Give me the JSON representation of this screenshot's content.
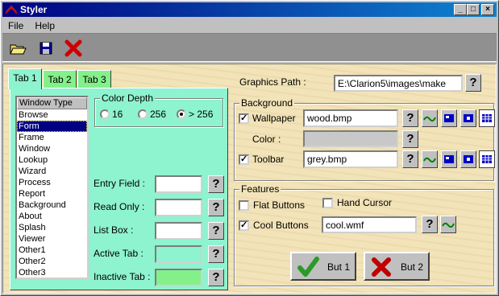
{
  "window": {
    "title": "Styler",
    "minimize": "_",
    "maximize": "□",
    "close": "×"
  },
  "menu": [
    "File",
    "Help"
  ],
  "toolbar": [
    {
      "name": "open-icon",
      "label": ""
    },
    {
      "name": "save-icon",
      "label": ""
    },
    {
      "name": "close-icon",
      "label": ""
    }
  ],
  "tabs": {
    "tab1": "Tab 1",
    "tab2": "Tab 2",
    "tab3": "Tab 3",
    "active": "Tab 1"
  },
  "tab1": {
    "window_type_header": "Window Type",
    "window_types": [
      "Browse",
      "Form",
      "Frame",
      "Window",
      "Lookup",
      "Wizard",
      "Process",
      "Report",
      "Background",
      "About",
      "Splash",
      "Viewer",
      "Other1",
      "Other2",
      "Other3"
    ],
    "selected_window_type": "Form",
    "color_depth": {
      "title": "Color Depth",
      "options": [
        "16",
        "256",
        "> 256"
      ],
      "selected": "> 256"
    },
    "color_fields": [
      {
        "label": "Entry Field :",
        "color": "#ffffff"
      },
      {
        "label": "Read Only :",
        "color": "#ffffff"
      },
      {
        "label": "List Box :",
        "color": "#ffffff"
      },
      {
        "label": "Active Tab :",
        "color": "#8ef3cf"
      },
      {
        "label": "Inactive Tab :",
        "color": "#84f08a"
      }
    ]
  },
  "graphics_path": {
    "label": "Graphics Path :",
    "value": "E:\\Clarion5\\images\\make"
  },
  "background": {
    "title": "Background",
    "wallpaper": {
      "label": "Wallpaper",
      "checked": true,
      "value": "wood.bmp"
    },
    "color": {
      "label": "Color :",
      "value": ""
    },
    "toolbar": {
      "label": "Toolbar",
      "checked": true,
      "value": "grey.bmp"
    }
  },
  "features": {
    "title": "Features",
    "flat_buttons": {
      "label": "Flat Buttons",
      "checked": false
    },
    "hand_cursor": {
      "label": "Hand Cursor",
      "checked": false
    },
    "cool_buttons": {
      "label": "Cool Buttons",
      "checked": true,
      "value": "cool.wmf"
    }
  },
  "buttons": {
    "but1": "But 1",
    "but2": "But 2"
  },
  "colors": {
    "titlebar": "#000080",
    "tab_active": "#8ef3cf",
    "tab_inactive": "#84f08a",
    "selection": "#000080",
    "client_bg": "#f2e3b8"
  }
}
